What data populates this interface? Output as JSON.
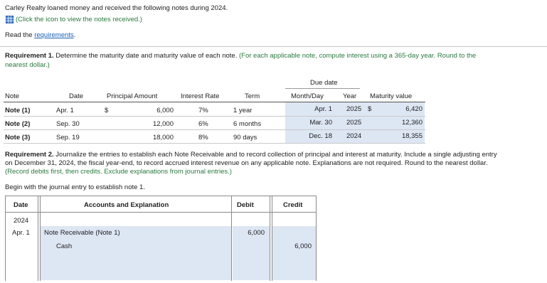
{
  "intro": {
    "text": "Carley Realty loaned money and received the following notes during 2024.",
    "icon_link": "(Click the icon to view the notes received.)",
    "read_prefix": "Read the ",
    "requirements_link": "requirements",
    "read_suffix": "."
  },
  "req1": {
    "heading": "Requirement 1.",
    "text": " Determine the maturity date and maturity value of each note.",
    "hint_line1": " (For each applicable note, compute interest using a 365-day year. Round to the",
    "hint_line2": "nearest dollar.)"
  },
  "notes_table": {
    "due_date_header": "Due date",
    "headers": {
      "note": "Note",
      "date": "Date",
      "principal": "Principal Amount",
      "rate": "Interest Rate",
      "term": "Term",
      "month_day": "Month/Day",
      "year": "Year",
      "maturity": "Maturity value"
    },
    "rows": [
      {
        "note": "Note (1)",
        "date": "Apr. 1",
        "dollar": "$",
        "principal": "6,000",
        "rate": "7%",
        "term": "1 year",
        "month_day": "Apr. 1",
        "year": "2025",
        "mv_dollar": "$",
        "maturity": "6,420"
      },
      {
        "note": "Note (2)",
        "date": "Sep. 30",
        "dollar": "",
        "principal": "12,000",
        "rate": "6%",
        "term": "6 months",
        "month_day": "Mar. 30",
        "year": "2025",
        "mv_dollar": "",
        "maturity": "12,360"
      },
      {
        "note": "Note (3)",
        "date": "Sep. 19",
        "dollar": "",
        "principal": "18,000",
        "rate": "8%",
        "term": "90 days",
        "month_day": "Dec. 18",
        "year": "2024",
        "mv_dollar": "",
        "maturity": "18,355"
      }
    ]
  },
  "req2": {
    "heading": "Requirement 2.",
    "line1": " Journalize the entries to establish each Note Receivable and to record collection of principal and interest at maturity. Include a single adjusting entry",
    "line2": "on December 31, 2024, the fiscal year-end, to record accrued interest revenue on any applicable note. Explanations are not required. Round to the nearest dollar.",
    "hint": "(Record debits first, then credits. Exclude explanations from journal entries.)",
    "begin": "Begin with the journal entry to establish note 1."
  },
  "journal": {
    "headers": {
      "date": "Date",
      "accounts": "Accounts and Explanation",
      "debit": "Debit",
      "credit": "Credit"
    },
    "year": "2024",
    "rows": [
      {
        "date": "Apr. 1",
        "account": "Note Receivable (Note 1)",
        "debit": "6,000",
        "credit": ""
      },
      {
        "date": "",
        "account": "Cash",
        "debit": "",
        "credit": "6,000"
      }
    ]
  },
  "colors": {
    "hint_green": "#2a7a3e",
    "link_blue": "#1a5fb4",
    "input_shade": "#dde6f3"
  }
}
